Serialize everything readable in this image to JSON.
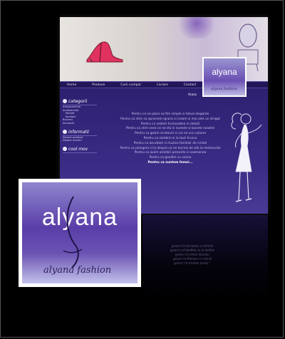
{
  "colors": {
    "primary": "#2b1d66",
    "accent": "#6a3fb0",
    "shoe": "#e0325f"
  },
  "brand": {
    "name": "alyana",
    "script": "alyana fashion"
  },
  "nav": {
    "items": [
      "Home",
      "Produse",
      "Cum cumpar",
      "Livrare",
      "Contact"
    ]
  },
  "sidebar": {
    "sections": [
      {
        "title": "categorii",
        "items": [
          "Imbracaminte",
          "Incaltaminte",
          "Pantofi",
          "Sandale",
          "Bocanci",
          "Accesorii"
        ]
      },
      {
        "title": "informatii",
        "items": [
          "Despre produse",
          "Despre marimi"
        ]
      },
      {
        "title": "cool mov",
        "items": []
      }
    ]
  },
  "main": {
    "heading": "Acasa"
  },
  "poem": {
    "lines": [
      "Pentru ca ne place sa fim simple si totusi elegante",
      "Pentru ca stim sa apreciem ignora si cream si mai ales un strigat",
      "Pentru ca vedem frumusetea in detalii",
      "Pentru ca stim ceea ce ne sta si numele si bunele noastre",
      "Pentru ca gasim sirateurii si cui ne ura culoare",
      "Pentru ca zambim si ia tavii frunsa",
      "Pentru ca ascultam si muzica fosilelor de cristal",
      "Pentru ca plangem si la despre ca ne tocmai de zile la melancolie",
      "Pentru ca avem amintiri presente si asemenea",
      "Pentru ca gandim cu voinia",
      "Pentru ca suntem femei..."
    ]
  },
  "reflection": {
    "lines": [
      "Pentru ca suntem femei...",
      "Pentru ca gandim cu voinia",
      "Pentru ca avem amintiri",
      "Pentru ca plangem si la despre",
      "Pentru ca ascultam si muzica"
    ]
  }
}
